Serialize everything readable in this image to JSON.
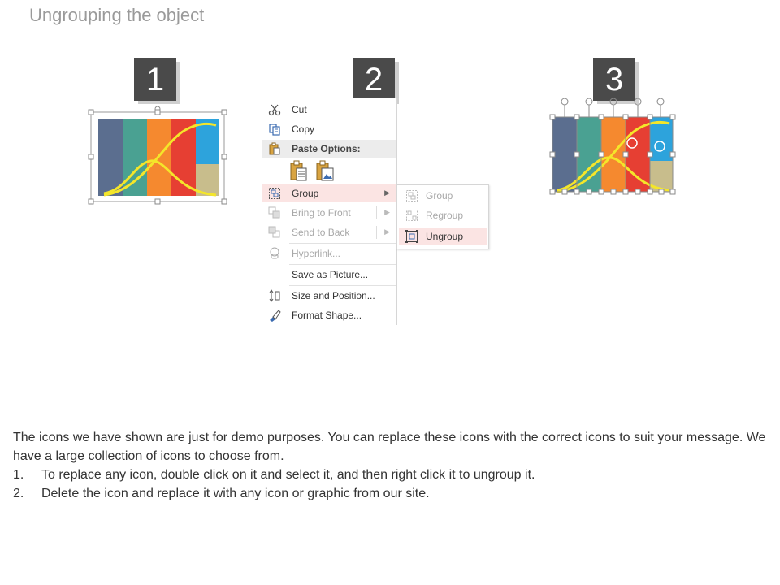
{
  "page": {
    "title": "Ungrouping the object"
  },
  "steps": [
    "1",
    "2",
    "3"
  ],
  "colors": {
    "stripe_blue_gray": "#5b6e8f",
    "stripe_teal": "#4aa192",
    "stripe_orange": "#f5892f",
    "stripe_red": "#e63f33",
    "stripe_sky": "#2da3dc",
    "stripe_khaki": "#c8bd8c",
    "curve": "#f4e62a",
    "menu_hover": "#fbe4e3"
  },
  "context_menu": {
    "cut": "Cut",
    "copy": "Copy",
    "paste_options": "Paste Options:",
    "group": "Group",
    "bring_to_front": "Bring to Front",
    "send_to_back": "Send to Back",
    "hyperlink": "Hyperlink...",
    "save_as_picture": "Save as Picture...",
    "size_and_position": "Size and Position...",
    "format_shape": "Format Shape..."
  },
  "submenu": {
    "group": "Group",
    "regroup": "Regroup",
    "ungroup": "Ungroup"
  },
  "description": {
    "intro": "The icons we have shown are just for demo purposes. You can replace these icons with the correct icons to suit your message. We have a large collection of icons to choose from.",
    "items": [
      {
        "num": "1.",
        "text": "To replace any icon, double click on it and select it, and then right click it to ungroup it."
      },
      {
        "num": "2.",
        "text": "Delete the icon and replace it with any icon or graphic from our site."
      }
    ]
  }
}
